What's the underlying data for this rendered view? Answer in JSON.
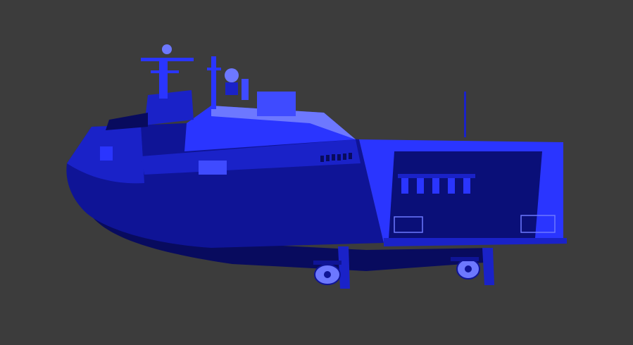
{
  "viewport": {
    "background": "#3c3c3c",
    "subject": "ship-3d-model-render"
  },
  "palette": {
    "hull_dark": "#0f1496",
    "hull_mid": "#1a22c8",
    "hull_light": "#2a35ff",
    "super_light": "#3f4bff",
    "highlight": "#6d78ff",
    "shadow": "#080b5e",
    "interior": "#0a0f78"
  }
}
